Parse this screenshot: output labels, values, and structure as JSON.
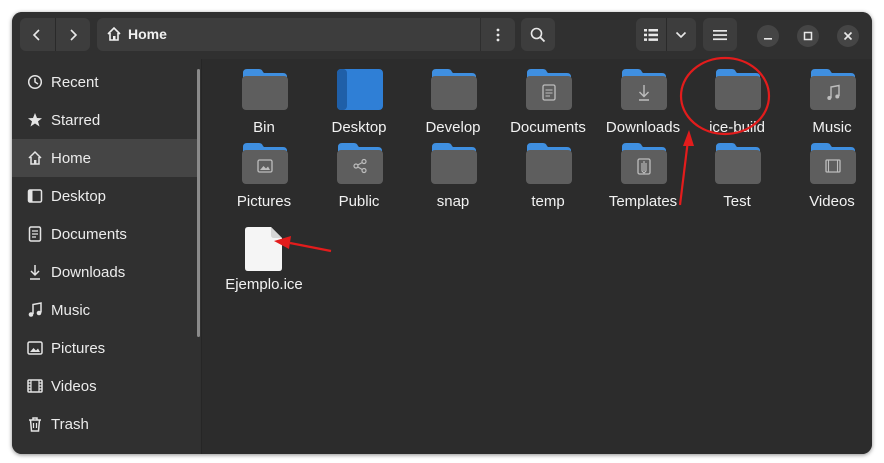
{
  "header": {
    "path": {
      "label": "Home",
      "icon": "home-icon"
    },
    "nav": {
      "back_icon": "chevron-left-icon",
      "forward_icon": "chevron-right-icon"
    },
    "buttons": {
      "path_menu_icon": "vertical-ellipsis-icon",
      "search_icon": "search-icon",
      "view_list_icon": "list-view-icon",
      "view_dropdown_icon": "chevron-down-icon",
      "main_menu_icon": "hamburger-menu-icon"
    },
    "window_controls": {
      "minimize": "minimize-icon",
      "maximize": "maximize-icon",
      "close": "close-icon"
    }
  },
  "sidebar": {
    "items": [
      {
        "label": "Recent",
        "icon": "clock-icon",
        "active": false
      },
      {
        "label": "Starred",
        "icon": "star-icon",
        "active": false
      },
      {
        "label": "Home",
        "icon": "home-icon",
        "active": true
      },
      {
        "label": "Desktop",
        "icon": "desktop-icon",
        "active": false
      },
      {
        "label": "Documents",
        "icon": "document-icon",
        "active": false
      },
      {
        "label": "Downloads",
        "icon": "download-icon",
        "active": false
      },
      {
        "label": "Music",
        "icon": "music-icon",
        "active": false
      },
      {
        "label": "Pictures",
        "icon": "picture-icon",
        "active": false
      },
      {
        "label": "Videos",
        "icon": "video-icon",
        "active": false
      },
      {
        "label": "Trash",
        "icon": "trash-icon",
        "active": false
      }
    ]
  },
  "files": [
    {
      "name": "Bin",
      "kind": "folder"
    },
    {
      "name": "Desktop",
      "kind": "desktop-folder"
    },
    {
      "name": "Develop",
      "kind": "folder"
    },
    {
      "name": "Documents",
      "kind": "documents-folder"
    },
    {
      "name": "Downloads",
      "kind": "downloads-folder"
    },
    {
      "name": "ice-build",
      "kind": "folder"
    },
    {
      "name": "Music",
      "kind": "music-folder"
    },
    {
      "name": "Pictures",
      "kind": "pictures-folder"
    },
    {
      "name": "Public",
      "kind": "public-folder"
    },
    {
      "name": "snap",
      "kind": "folder"
    },
    {
      "name": "temp",
      "kind": "folder"
    },
    {
      "name": "Templates",
      "kind": "templates-folder"
    },
    {
      "name": "Test",
      "kind": "folder"
    },
    {
      "name": "Videos",
      "kind": "videos-folder"
    },
    {
      "name": "Ejemplo.ice",
      "kind": "file"
    }
  ],
  "colors": {
    "folder_tab": "#3f8fe0",
    "folder_body": "#5e5e5e",
    "desktop_folder": "#2f7fd6",
    "annotation": "#e31c1c"
  }
}
